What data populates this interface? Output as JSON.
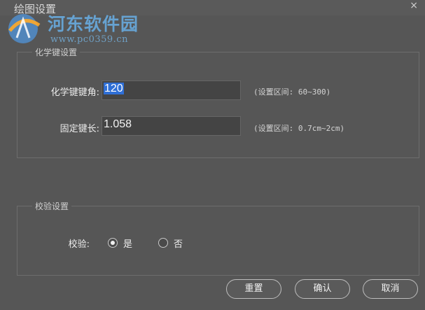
{
  "window": {
    "title": "绘图设置",
    "close_glyph": "×"
  },
  "watermark": {
    "name": "河东软件园",
    "url": "www.pc0359.cn"
  },
  "chem_group": {
    "legend": "化学键设置",
    "angle_label": "化学键键角:",
    "angle_value": "120",
    "angle_hint": "(设置区间: 60~300)",
    "length_label": "固定键长:",
    "length_value": "1.058",
    "length_hint": "(设置区间: 0.7cm~2cm)"
  },
  "check_group": {
    "legend": "校验设置",
    "label": "校验:",
    "options": [
      {
        "label": "是",
        "checked": true
      },
      {
        "label": "否",
        "checked": false
      }
    ]
  },
  "buttons": {
    "reset": "重置",
    "confirm": "确认",
    "cancel": "取消"
  },
  "colors": {
    "background": "#565656",
    "input_bg": "#444444",
    "selection": "#2f6fd6"
  }
}
